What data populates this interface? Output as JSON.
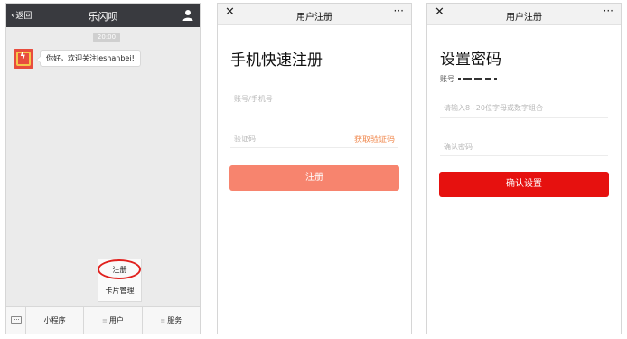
{
  "chat": {
    "back_label": "返回",
    "title": "乐闪呗",
    "timestamp": "20:00",
    "message": "你好，欢迎关注leshanbei!",
    "menu": {
      "item1": "注册",
      "item2": "卡片管理"
    },
    "bottom": {
      "b1": "小程序",
      "b2": "用户",
      "b3": "服务"
    },
    "icons": {
      "user": "user-icon",
      "keyboard": "keyboard-icon",
      "back": "chevron-left-icon",
      "avatar": "leshanbei-logo"
    },
    "colors": {
      "header": "#393a3f",
      "highlight": "#e0201d",
      "avatar": "#e84c3d"
    }
  },
  "register": {
    "title": "用户注册",
    "heading": "手机快速注册",
    "account_placeholder": "账号/手机号",
    "code_placeholder": "验证码",
    "get_code": "获取验证码",
    "submit": "注册",
    "icons": {
      "close": "close-icon",
      "more": "more-icon"
    },
    "colors": {
      "button": "#f7846e",
      "link": "#f08a50"
    }
  },
  "password": {
    "title": "用户注册",
    "heading": "设置密码",
    "account_label": "账号",
    "pwd_placeholder": "请输入8~20位字母或数字组合",
    "confirm_placeholder": "确认密码",
    "submit": "确认设置",
    "icons": {
      "close": "close-icon",
      "more": "more-icon"
    },
    "colors": {
      "button": "#e6110f"
    }
  }
}
